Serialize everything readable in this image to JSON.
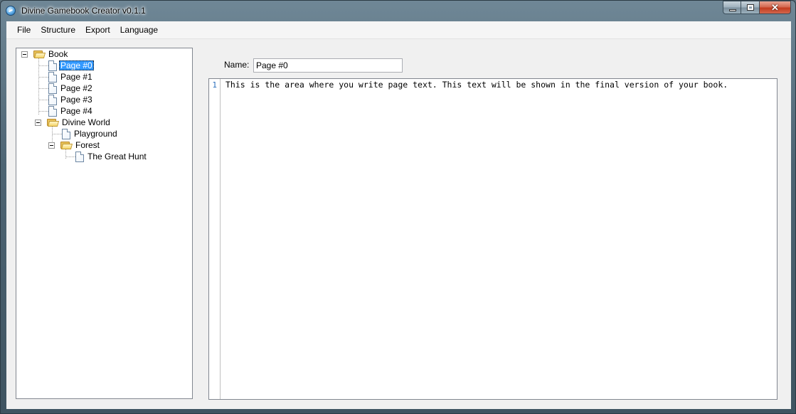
{
  "window": {
    "title": "Divine Gamebook Creator v0.1.1"
  },
  "menu": {
    "items": [
      "File",
      "Structure",
      "Export",
      "Language"
    ]
  },
  "tree": {
    "root": {
      "label": "Book"
    },
    "pages": [
      "Page #0",
      "Page #1",
      "Page #2",
      "Page #3",
      "Page #4"
    ],
    "selected": "Page #0",
    "subfolder": {
      "label": "Divine World",
      "pages": [
        "Playground"
      ],
      "subfolder": {
        "label": "Forest",
        "pages": [
          "The Great Hunt"
        ]
      }
    }
  },
  "editor": {
    "name_label": "Name:",
    "name_value": "Page #0",
    "line_number": "1",
    "text": "This is the area where you write page text. This text will be shown in the final version of your book."
  },
  "icons": {
    "app": "app-globe-icon",
    "folder": "folder-open-icon",
    "page": "page-document-icon"
  },
  "colors": {
    "selection": "#3399ff",
    "line_number": "#2b6fbd"
  }
}
